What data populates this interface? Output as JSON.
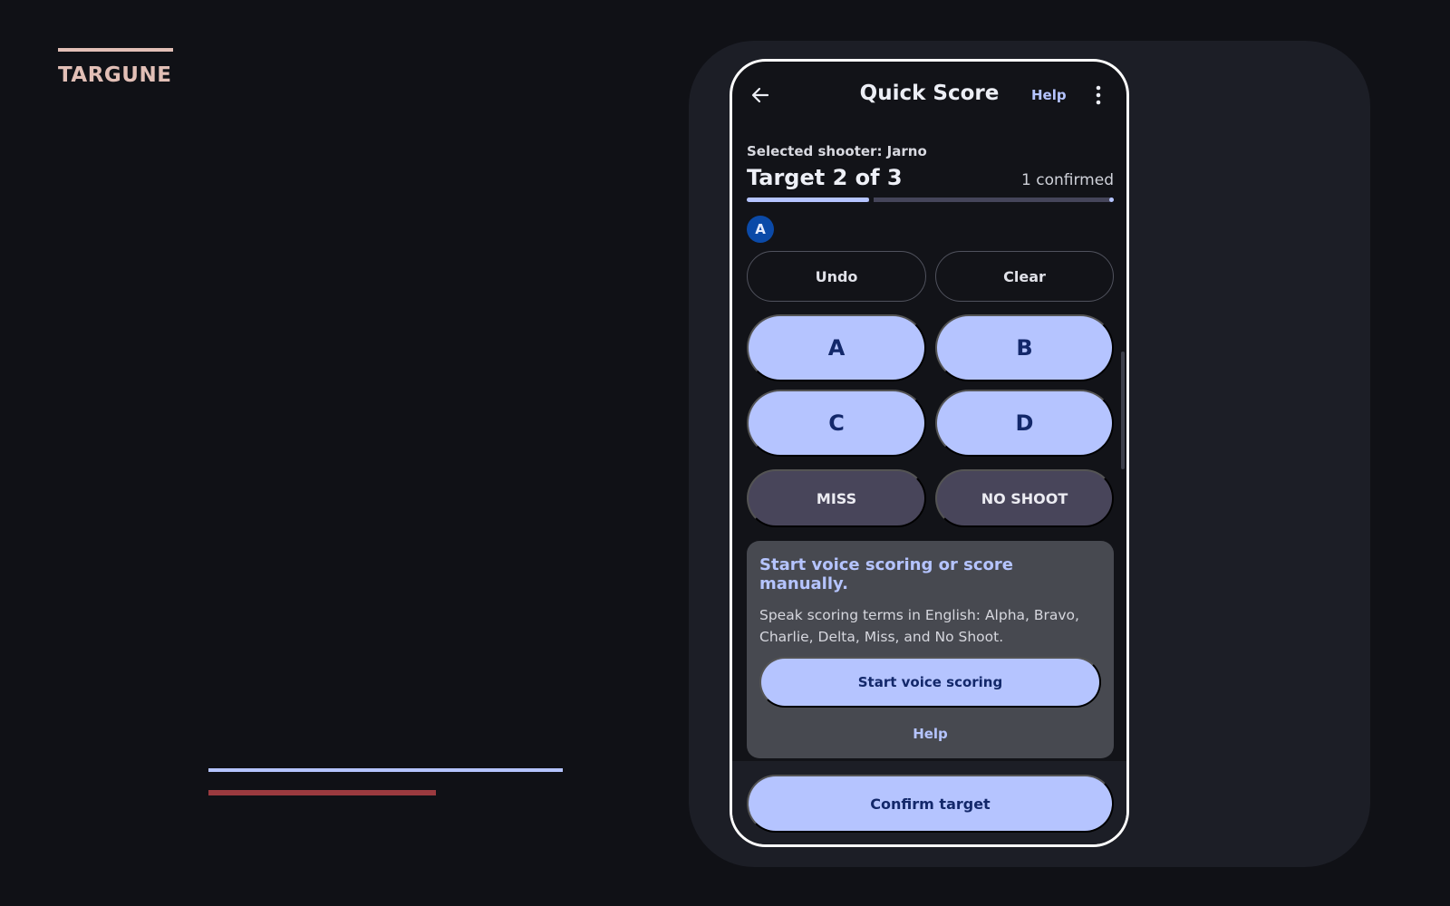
{
  "brand": {
    "name": "TARGUNE"
  },
  "colors": {
    "accent": "#b5c4ff",
    "brand": "#e2bfb6",
    "alert_line": "#9b3a3f",
    "chip": "#0b4aa8",
    "background": "#101116",
    "surface": "#1c1e26"
  },
  "appbar": {
    "back_icon": "arrow-left-icon",
    "title": "Quick Score",
    "help_label": "Help",
    "more_icon": "more-vertical-icon"
  },
  "status": {
    "selected_shooter": "Selected shooter: Jarno",
    "target_label": "Target 2 of 3",
    "confirmed_label": "1 confirmed",
    "progress_fraction": 0.333
  },
  "hits": [
    "A"
  ],
  "controls": {
    "undo_label": "Undo",
    "clear_label": "Clear"
  },
  "zones": [
    "A",
    "B",
    "C",
    "D"
  ],
  "penalties": [
    "MISS",
    "NO SHOOT"
  ],
  "voice": {
    "title": "Start voice scoring or score manually.",
    "description": "Speak scoring terms in English: Alpha, Bravo, Charlie, Delta, Miss, and No Shoot.",
    "start_label": "Start voice scoring",
    "help_label": "Help"
  },
  "footer": {
    "confirm_label": "Confirm target"
  }
}
